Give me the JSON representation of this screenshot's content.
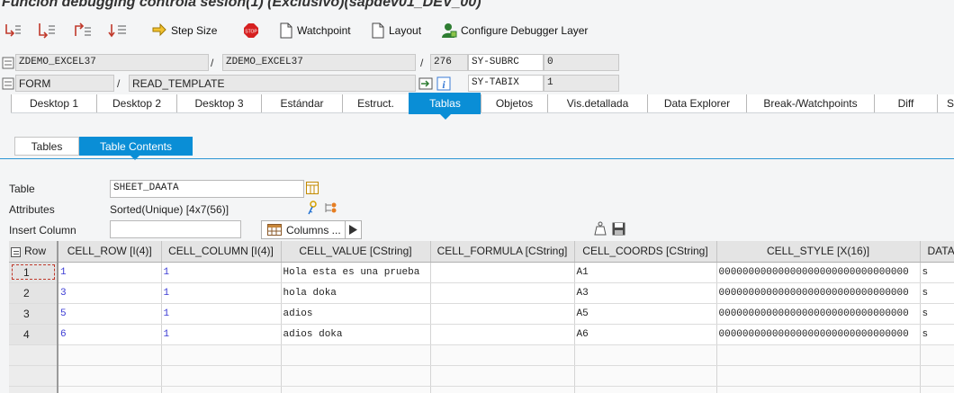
{
  "window": {
    "title": "Función debugging controla sesión(1)  (Exclusivo)(sapdev01_DEV_00)"
  },
  "toolbar": {
    "step_size": "Step Size",
    "watchpoint": "Watchpoint",
    "layout": "Layout",
    "configure_layer": "Configure Debugger Layer"
  },
  "header": {
    "program": "ZDEMO_EXCEL37",
    "include": "ZDEMO_EXCEL37",
    "line": "276",
    "sy_subrc_label": "SY-SUBRC",
    "sy_subrc_value": "0",
    "event_type": "FORM",
    "event_name": "READ_TEMPLATE",
    "sy_tabix_label": "SY-TABIX",
    "sy_tabix_value": "1",
    "slash": "/"
  },
  "tabs": [
    "Desktop 1",
    "Desktop 2",
    "Desktop 3",
    "Estándar",
    "Estruct.",
    "Tablas",
    "Objetos",
    "Vis.detallada",
    "Data Explorer",
    "Break-/Watchpoints",
    "Diff",
    "S"
  ],
  "active_tab": "Tablas",
  "subtabs": [
    "Tables",
    "Table Contents"
  ],
  "active_subtab": "Table Contents",
  "form": {
    "table_label": "Table",
    "table_value": "SHEET_DAATA",
    "attributes_label": "Attributes",
    "attributes_value": "Sorted(Unique) [4x7(56)]",
    "insert_column_label": "Insert Column",
    "insert_column_value": "",
    "columns_button": "Columns ..."
  },
  "grid": {
    "columns": [
      "Row",
      "CELL_ROW [I(4)]",
      "CELL_COLUMN [I(4)]",
      "CELL_VALUE [CString]",
      "CELL_FORMULA [CString]",
      "CELL_COORDS [CString]",
      "CELL_STYLE [X(16)]",
      "DATA"
    ],
    "rows": [
      [
        "1",
        "1",
        "1",
        "Hola esta es una prueba",
        "",
        "A1",
        "00000000000000000000000000000000",
        "s"
      ],
      [
        "2",
        "3",
        "1",
        "hola doka",
        "",
        "A3",
        "00000000000000000000000000000000",
        "s"
      ],
      [
        "3",
        "5",
        "1",
        "adios",
        "",
        "A5",
        "00000000000000000000000000000000",
        "s"
      ],
      [
        "4",
        "6",
        "1",
        "adios doka",
        "",
        "A6",
        "00000000000000000000000000000000",
        "s"
      ]
    ]
  },
  "colors": {
    "accent": "#0a8ed6",
    "number": "#3b3bd4",
    "header_bg": "#e4e4e4"
  }
}
